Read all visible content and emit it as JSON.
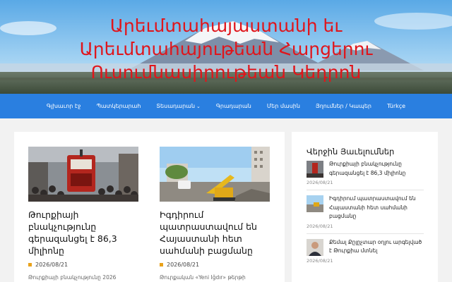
{
  "site": {
    "title_lines": [
      "Արեւմտահայաստանի եւ",
      "Արեւմտահայութեան Հարցերու",
      "Ուսումնասիրութեան Կեդրոն"
    ]
  },
  "nav": {
    "items": [
      {
        "label": "Գլխաւոր էջ"
      },
      {
        "label": "Պատկերարահ"
      },
      {
        "label": "Տեսադարան"
      },
      {
        "label": "Գրադարան"
      },
      {
        "label": "Մեր մասին"
      },
      {
        "label": "Յղումներ / Կապեր"
      },
      {
        "label": "Türkçe"
      }
    ]
  },
  "posts": [
    {
      "title": "Թուրքիայի բնակչությունը գերազանցել է 86,3 միլիոնը",
      "date": "2026/08/21",
      "excerpt": "Թուրքիայի բնակչությունը 2026"
    },
    {
      "title": "Իգդիրում պատրաստավում են Հայաստանի հետ սահմանի բացմանը",
      "date": "2026/08/21",
      "excerpt": "Թուրքական «Yeni Iğdır» թերթի հաղորդմամբ"
    }
  ],
  "sidebar": {
    "heading": "Վերջին Յաւելումներ",
    "items": [
      {
        "text": "Թուրքիայի բնակչությունը գերազանցել է 86,3 միլիոնը",
        "date": "2026/08/21"
      },
      {
        "text": "Իգդիրում պատրաստավում են Հայաստանի հետ սահմանի բացմանը",
        "date": "2026/08/21"
      },
      {
        "text": "Քեմալ Քըլըչտար օղլու արգելված է Թուրքիա մտնել",
        "date": "2026/08/21"
      }
    ]
  },
  "colors": {
    "title_red": "#e0151b",
    "nav_blue": "#2a7fe0",
    "date_marker": "#e9a21b"
  }
}
